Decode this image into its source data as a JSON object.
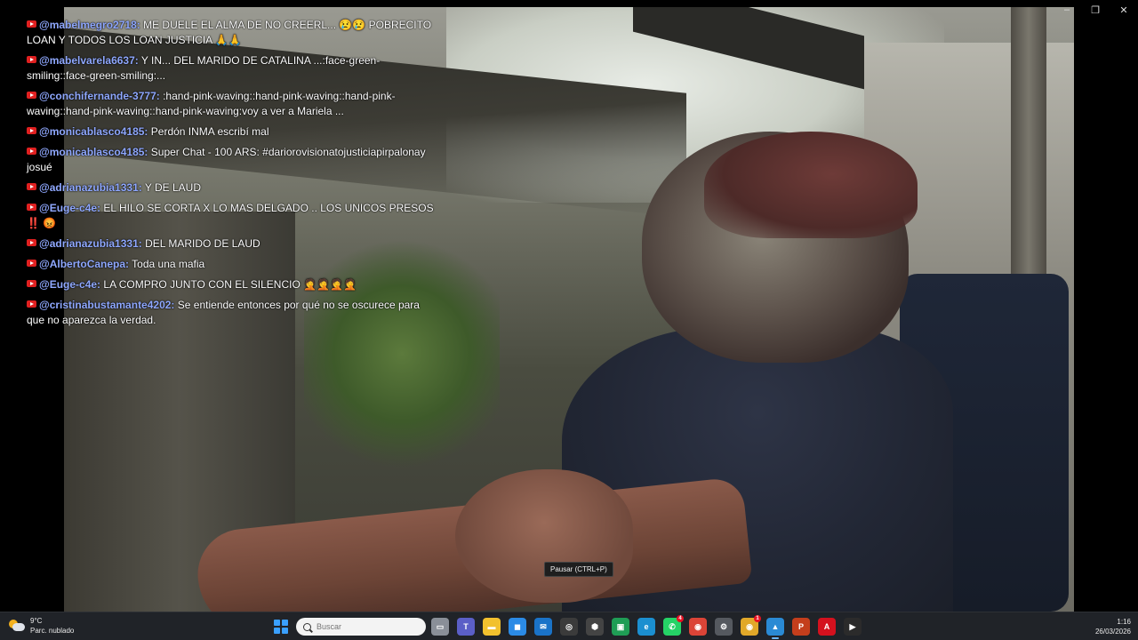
{
  "window": {
    "minimize_label": "–",
    "maximize_label": "❐",
    "close_label": "✕"
  },
  "chat": {
    "messages": [
      {
        "author": "@mabelmegro2718:",
        "text": "ME DUELE EL ALMA DE NO CREERL... 😢😢 POBRECITO LOAN Y TODOS LOS LOAN JUSTICIA 🙏🙏"
      },
      {
        "author": "@mabelvarela6637:",
        "text": "Y IN... DEL MARIDO DE CATALINA ...:face-green-smiling::face-green-smiling:..."
      },
      {
        "author": "@conchifernande-3777:",
        "text": ":hand-pink-waving::hand-pink-waving::hand-pink-waving::hand-pink-waving::hand-pink-waving:voy a ver a Mariela ..."
      },
      {
        "author": "@monicablasco4185:",
        "text": "Perdón INMA escribí mal"
      },
      {
        "author": "@monicablasco4185:",
        "text": "Super Chat - 100 ARS: #dariorovisionatojusticiapirpalonay josué"
      },
      {
        "author": "@adrianazubia1331:",
        "text": "Y DE LAUD"
      },
      {
        "author": "@Euge-c4e:",
        "text": "EL HILO SE CORTA X LO MAS DELGADO .. LOS UNICOS PRESOS ‼️ 😡"
      },
      {
        "author": "@adrianazubia1331:",
        "text": "DEL MARIDO DE LAUD"
      },
      {
        "author": "@AlbertoCanepa:",
        "text": "Toda una mafia"
      },
      {
        "author": "@Euge-c4e:",
        "text": "LA COMPRO JUNTO CON EL SILENCIO 🤦🤦🤦🤦"
      },
      {
        "author": "@cristinabustamante4202:",
        "text": "Se entiende entonces por qué no se oscurece para que no aparezca la verdad."
      }
    ]
  },
  "tooltip": "Pausar (CTRL+P)",
  "taskbar": {
    "weather": {
      "temp": "9°C",
      "desc": "Parc. nublado"
    },
    "search_placeholder": "Buscar",
    "apps": [
      {
        "name": "task-view-icon",
        "glyph": "▭",
        "color": "#8a8f98"
      },
      {
        "name": "teams-icon",
        "glyph": "T",
        "color": "#5b5fc7"
      },
      {
        "name": "file-explorer-icon",
        "glyph": "▬",
        "color": "#f2c12e"
      },
      {
        "name": "store-icon",
        "glyph": "◼",
        "color": "#2b8be6"
      },
      {
        "name": "mail-icon",
        "glyph": "✉",
        "color": "#1a73c8"
      },
      {
        "name": "obs-icon",
        "glyph": "◎",
        "color": "#3b3b3b"
      },
      {
        "name": "cube-icon",
        "glyph": "⬢",
        "color": "#444"
      },
      {
        "name": "spreadsheet-icon",
        "glyph": "▣",
        "color": "#1f9d55"
      },
      {
        "name": "edge-icon",
        "glyph": "e",
        "color": "#1b8fd0"
      },
      {
        "name": "whatsapp-icon",
        "glyph": "✆",
        "color": "#25d366"
      },
      {
        "name": "chrome-icon",
        "glyph": "◉",
        "color": "#db4437"
      },
      {
        "name": "settings-icon",
        "glyph": "⚙",
        "color": "#55595f"
      },
      {
        "name": "chrome-2-icon",
        "glyph": "◉",
        "color": "#e1a829"
      },
      {
        "name": "photos-icon",
        "glyph": "▲",
        "color": "#2a8ad4"
      },
      {
        "name": "powerpoint-icon",
        "glyph": "P",
        "color": "#c43e1c"
      },
      {
        "name": "acrobat-icon",
        "glyph": "A",
        "color": "#d4111e"
      },
      {
        "name": "media-player-icon",
        "glyph": "▶",
        "color": "#2b2b2b"
      }
    ],
    "badges": {
      "whatsapp": "4",
      "chrome": "1"
    },
    "clock": {
      "time": "1:16",
      "date": "26/03/2026"
    }
  }
}
